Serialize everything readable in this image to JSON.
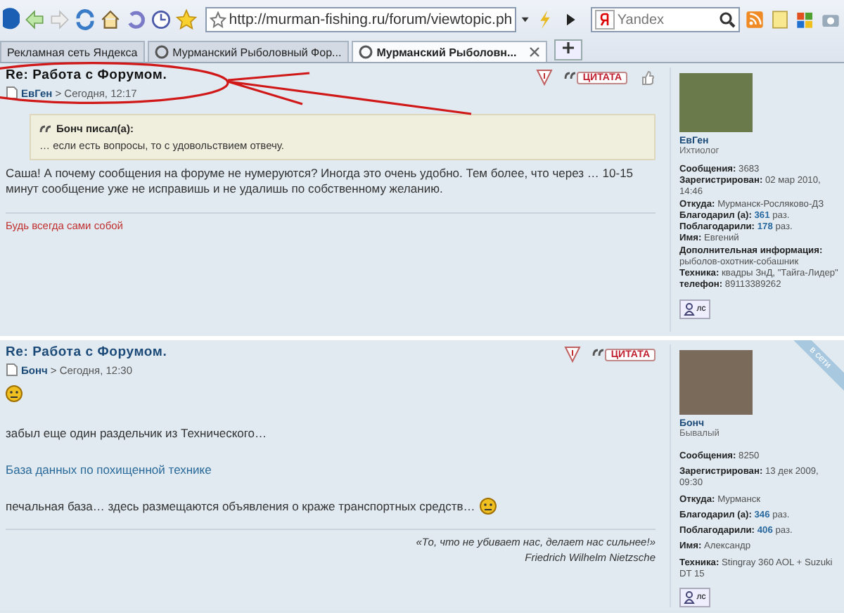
{
  "address": {
    "value": "http://murman-fishing.ru/forum/viewtopic.ph"
  },
  "search": {
    "placeholder": "Yandex"
  },
  "tabs": [
    {
      "label": "Рекламная сеть Яндекса",
      "selected": false,
      "favicon": false
    },
    {
      "label": "Мурманский Рыболовный Фор...",
      "selected": false,
      "favicon": true
    },
    {
      "label": "Мурманский Рыболовн...",
      "selected": true,
      "favicon": true
    }
  ],
  "posts": [
    {
      "title": "Re: Работа с Форумом.",
      "author": "ЕвГен",
      "time": "> Сегодня, 12:17",
      "quote_button": "ЦИТАТА",
      "thanks_button": true,
      "quote": {
        "author": "Бонч писал(а):",
        "text": "… если есть вопросы, то с удовольствием отвечу."
      },
      "body": [
        {
          "kind": "text",
          "text": "Саша! А почему сообщения на форуме не нумеруются? Иногда это очень удобно. Тем более, что через … 10-15 минут сообщение уже не исправишь и не удалишь по собственному желанию."
        }
      ],
      "signature": {
        "kind": "motto",
        "lines": [
          "Будь всегда сами собой"
        ]
      },
      "profile": {
        "name": "ЕвГен",
        "rank": "Ихтиолог",
        "online": false,
        "fields": [
          {
            "label": "Сообщения:",
            "value": "3683"
          },
          {
            "label": "Зарегистрирован:",
            "value": "02 мар 2010, 14:46"
          },
          {
            "label": "Откуда:",
            "value": "Мурманск-Росляково-ДЗ"
          },
          {
            "label": "Благодарил (а):",
            "value": "**361** раз."
          },
          {
            "label": "Поблагодарили:",
            "value": "**178** раз."
          },
          {
            "label": "Имя:",
            "value": "Евгений"
          },
          {
            "label": "Дополнительная информация:",
            "value": "рыболов-охотник-собашник"
          },
          {
            "label": "Техника:",
            "value": "квадры ЗнД, \"Тайга-Лидер\""
          },
          {
            "label": "телефон:",
            "value": "89113389262"
          }
        ],
        "pm_button": "лс"
      }
    },
    {
      "title": "Re: Работа с Форумом.",
      "author": "Бонч",
      "time": "> Сегодня, 12:30",
      "quote_button": "ЦИТАТА",
      "thanks_button": false,
      "body": [
        {
          "kind": "smiley"
        },
        {
          "kind": "text",
          "text": "забыл еще один раздельчик из Технического…"
        },
        {
          "kind": "link",
          "text": "База данных по похищенной технике"
        },
        {
          "kind": "text_smiley",
          "text": "печальная база… здесь размещаются объявления о краже транспортных средств…"
        }
      ],
      "signature": {
        "kind": "quote",
        "lines": [
          "«То, что не убивает нас, делает нас сильнее!»",
          "Friedrich Wilhelm Nietzsche"
        ]
      },
      "profile": {
        "name": "Бонч",
        "rank": "Бывалый",
        "online": true,
        "online_label": "в сети",
        "fields": [
          {
            "label": "Сообщения:",
            "value": "8250"
          },
          {
            "label": "Зарегистрирован:",
            "value": "13 дек 2009, 09:30"
          },
          {
            "label": "Откуда:",
            "value": "Мурманск"
          },
          {
            "label": "Благодарил (а):",
            "value": "**346** раз."
          },
          {
            "label": "Поблагодарили:",
            "value": "**406** раз."
          },
          {
            "label": "Имя:",
            "value": "Александр"
          },
          {
            "label": "Техника:",
            "value": "Stingray 360 AOL + Suzuki DT 15"
          }
        ],
        "pm_button": "лс"
      }
    }
  ]
}
